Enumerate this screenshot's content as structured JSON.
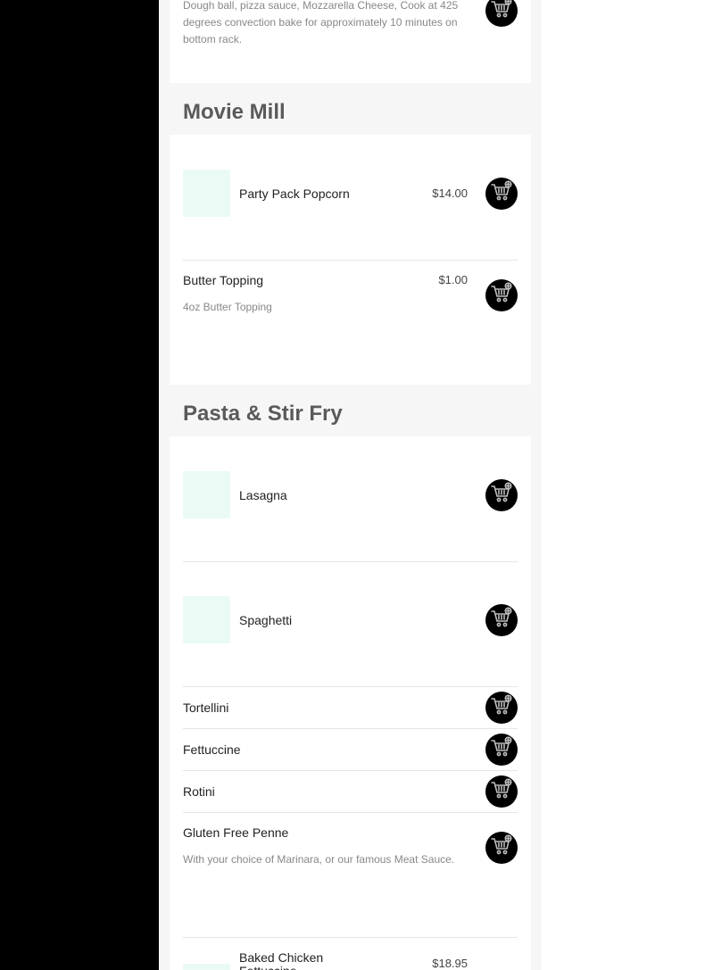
{
  "pizza_fragment": {
    "description": "Dough ball, pizza sauce, Mozzarella Cheese, Cook at 425 degrees convection bake for approximately 10 minutes on bottom rack."
  },
  "sections": {
    "movie_mill": {
      "title": "Movie Mill",
      "items": [
        {
          "name": "Party Pack Popcorn",
          "price": "$14.00"
        },
        {
          "name": "Butter Topping",
          "price": "$1.00",
          "description": "4oz Butter Topping"
        }
      ]
    },
    "pasta": {
      "title": "Pasta & Stir Fry",
      "items": [
        {
          "name": "Lasagna"
        },
        {
          "name": "Spaghetti"
        },
        {
          "name": "Tortellini"
        },
        {
          "name": "Fettuccine"
        },
        {
          "name": "Rotini"
        },
        {
          "name": "Gluten Free Penne",
          "description": "With your choice of Marinara, or our famous Meat Sauce."
        },
        {
          "name": "Baked Chicken Fettuccine",
          "price": "$18.95"
        }
      ]
    }
  },
  "icons": {
    "add_to_cart": "cart-plus-icon"
  },
  "colors": {
    "sidebar": "#000000",
    "thumb_placeholder": "#eafaf5",
    "section_title": "#5a5a5a"
  }
}
